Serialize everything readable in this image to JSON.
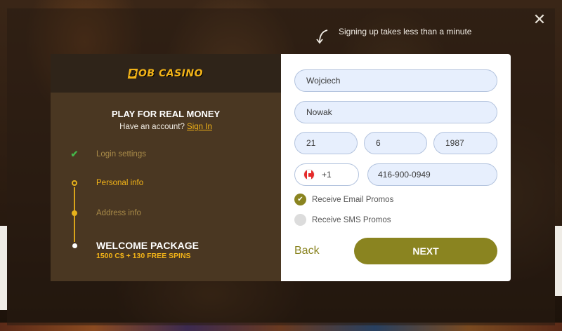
{
  "hint": {
    "text": "Signing up takes less than a minute"
  },
  "close": {
    "symbol": "✕"
  },
  "logo": {
    "mark": "B",
    "text": "OB CASINO"
  },
  "left": {
    "title": "PLAY FOR REAL MONEY",
    "have_account": "Have an account?",
    "sign_in": "Sign In",
    "steps": [
      {
        "label": "Login settings",
        "state": "done",
        "icon": "check-icon"
      },
      {
        "label": "Personal info",
        "state": "current",
        "icon": "step-dot-icon"
      },
      {
        "label": "Address info",
        "state": "pending",
        "icon": "step-dot-icon"
      }
    ],
    "welcome": {
      "title": "WELCOME PACKAGE",
      "subtitle": "1500 C$ + 130 FREE SPINS"
    }
  },
  "form": {
    "first_name": "Wojciech",
    "last_name": "Nowak",
    "day": "21",
    "month": "6",
    "year": "1987",
    "phone_prefix": "+1",
    "phone": "416-900-0949",
    "email_promos": {
      "label": "Receive Email Promos",
      "checked": true
    },
    "sms_promos": {
      "label": "Receive SMS Promos",
      "checked": false
    },
    "back_label": "Back",
    "next_label": "NEXT"
  },
  "colors": {
    "accent": "#8a8420",
    "brand_yellow": "#f2b318",
    "field_bg": "#e7effd"
  }
}
